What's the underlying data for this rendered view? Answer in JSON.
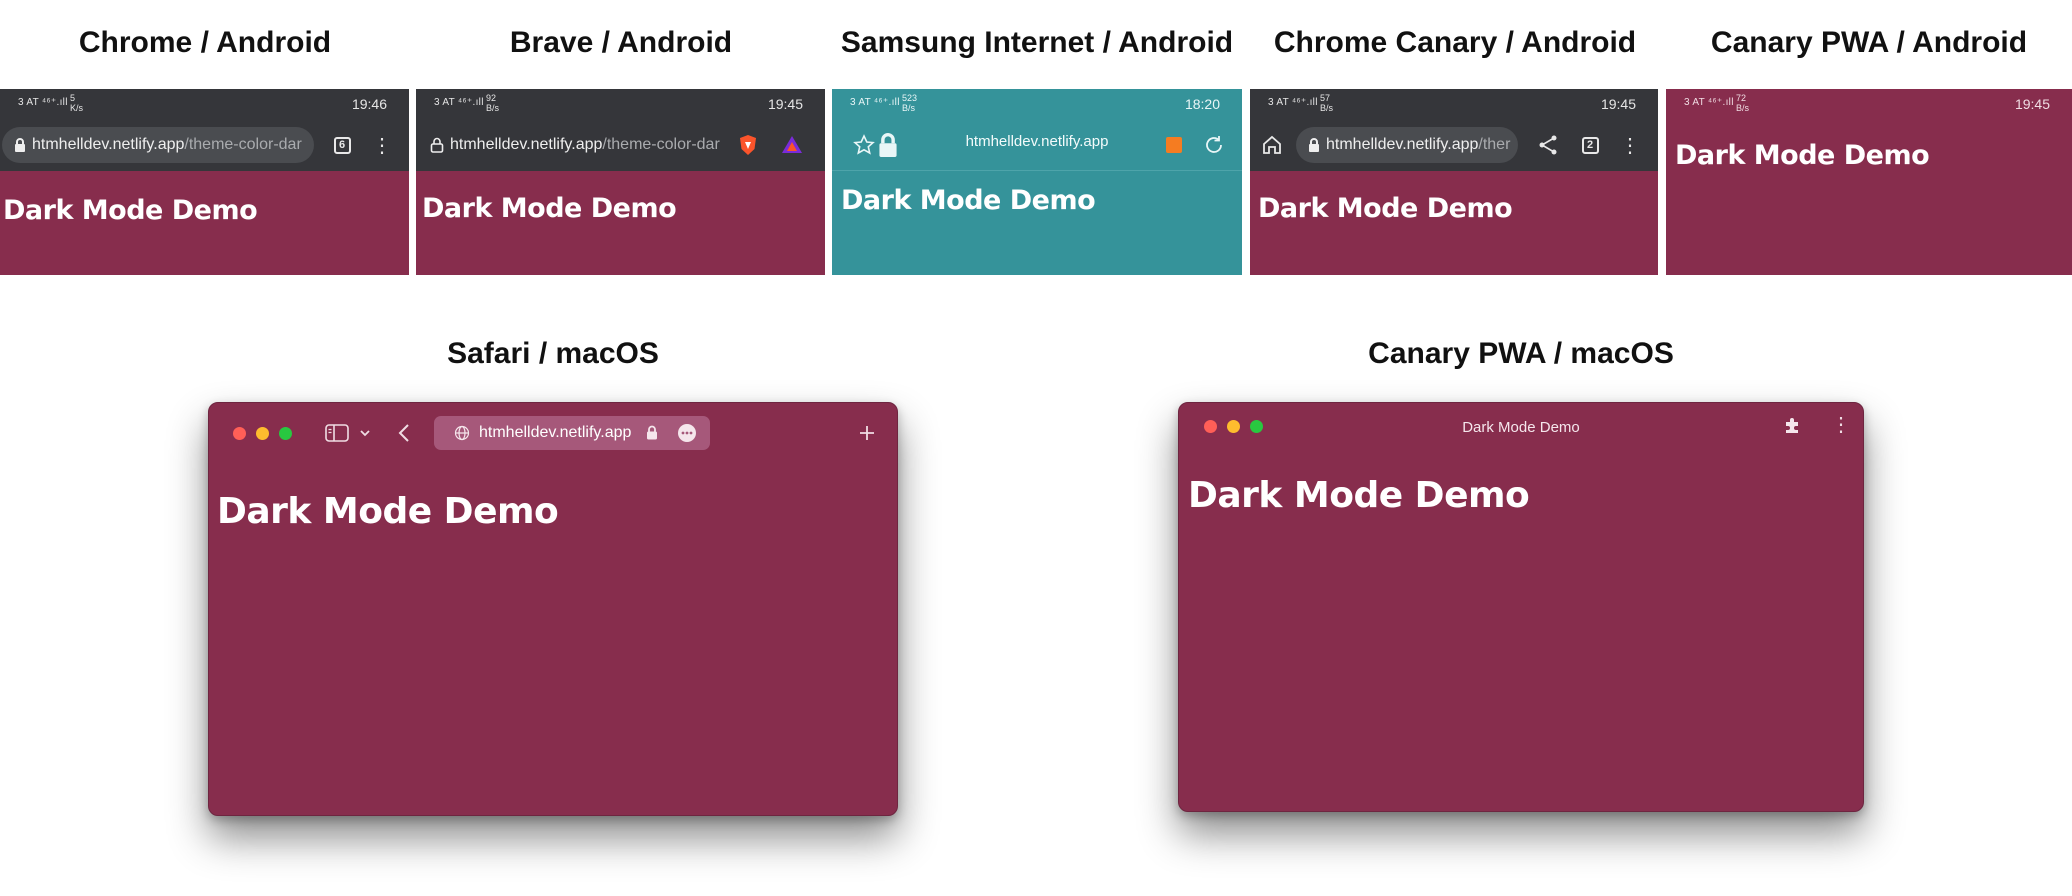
{
  "colors": {
    "theme": "#872d4d",
    "samsung_theme": "#35939a",
    "toolbar_dark": "#35363a"
  },
  "labels": {
    "chrome_android": "Chrome / Android",
    "brave_android": "Brave / Android",
    "samsung_android": "Samsung Internet / Android",
    "canary_android": "Chrome Canary / Android",
    "canary_pwa_android": "Canary PWA / Android",
    "safari_macos": "Safari / macOS",
    "canary_pwa_macos": "Canary PWA / macOS"
  },
  "page_heading": "Dark Mode Demo",
  "chrome": {
    "signal": "3 AT ⁴⁶⁺.ıll",
    "speed": "5\nK/s",
    "time": "19:46",
    "url_host": "htmhelldev.netlify.app",
    "url_path": "/theme-color-dar",
    "tab_count": "6"
  },
  "brave": {
    "signal": "3 AT ⁴⁶⁺.ıll",
    "speed": "92\nB/s",
    "time": "19:45",
    "url_host": "htmhelldev.netlify.app",
    "url_path": "/theme-color-dar"
  },
  "samsung": {
    "signal": "3 AT ⁴⁶⁺.ıll",
    "speed": "523\nB/s",
    "time": "18:20",
    "url_host": "htmhelldev.netlify.app"
  },
  "canary": {
    "signal": "3 AT ⁴⁶⁺.ıll",
    "speed": "57\nB/s",
    "time": "19:45",
    "url_host": "htmhelldev.netlify.app",
    "url_path": "/ther",
    "tab_count": "2"
  },
  "canary_pwa": {
    "signal": "3 AT ⁴⁶⁺.ıll",
    "speed": "72\nB/s",
    "time": "19:45"
  },
  "safari": {
    "url_host": "htmhelldev.netlify.app"
  },
  "pwa_mac": {
    "window_title": "Dark Mode Demo"
  }
}
